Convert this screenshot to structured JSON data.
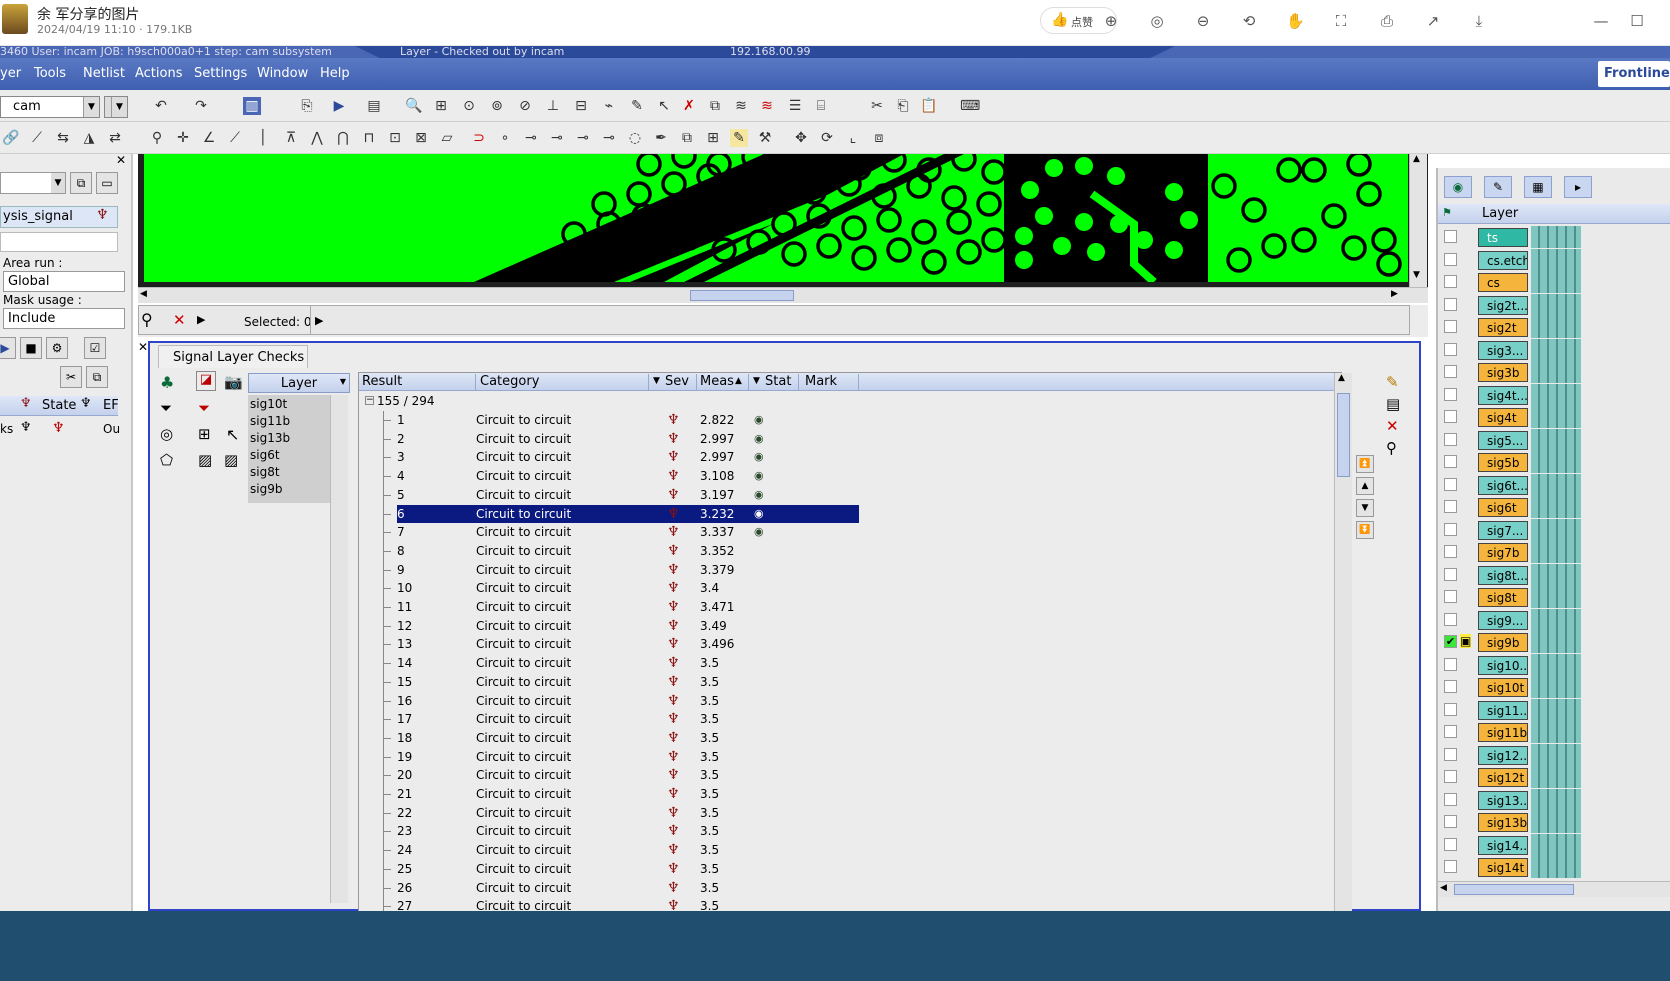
{
  "viewer": {
    "title": "余 军分享的图片",
    "meta": "2024/04/19 11:10 · 179.1KB",
    "like_label": "点赞"
  },
  "app_title": {
    "left": "3460  User: incam  JOB: h9sch000a0+1  step: cam  subsystem",
    "mid": "Layer - Checked out by incam",
    "host": "192.168.00.99"
  },
  "menu": [
    "yer",
    "Tools",
    "Netlist",
    "Actions",
    "Settings",
    "Window",
    "Help"
  ],
  "logo_text": "Frontline",
  "toolbar": {
    "step": "cam"
  },
  "left_panel": {
    "analysis": "ysis_signal",
    "area_run_label": "Area run :",
    "area_run_value": "Global",
    "mask_usage_label": "Mask usage :",
    "mask_usage_value": "Include",
    "state_label": "State",
    "er_label": "EF",
    "ks_label": "ks",
    "ou_label": "Ou"
  },
  "map": {
    "selected": "Selected: 0"
  },
  "checks": {
    "tab": "Signal Layer Checks",
    "layer_header": "Layer",
    "layers": [
      "sig10t",
      "sig11b",
      "sig13b",
      "sig6t",
      "sig8t",
      "sig9b"
    ],
    "columns": [
      "Result",
      "Category",
      "Sev",
      "Meas",
      "Stat",
      "Mark"
    ],
    "group": "155 / 294",
    "rows": [
      {
        "id": "1",
        "category": "Circuit to circuit",
        "meas": "2.822",
        "eye": true
      },
      {
        "id": "2",
        "category": "Circuit to circuit",
        "meas": "2.997",
        "eye": true
      },
      {
        "id": "3",
        "category": "Circuit to circuit",
        "meas": "2.997",
        "eye": true
      },
      {
        "id": "4",
        "category": "Circuit to circuit",
        "meas": "3.108",
        "eye": true
      },
      {
        "id": "5",
        "category": "Circuit to circuit",
        "meas": "3.197",
        "eye": true
      },
      {
        "id": "6",
        "category": "Circuit to circuit",
        "meas": "3.232",
        "eye": true,
        "selected": true
      },
      {
        "id": "7",
        "category": "Circuit to circuit",
        "meas": "3.337",
        "eye": true
      },
      {
        "id": "8",
        "category": "Circuit to circuit",
        "meas": "3.352"
      },
      {
        "id": "9",
        "category": "Circuit to circuit",
        "meas": "3.379"
      },
      {
        "id": "10",
        "category": "Circuit to circuit",
        "meas": "3.4"
      },
      {
        "id": "11",
        "category": "Circuit to circuit",
        "meas": "3.471"
      },
      {
        "id": "12",
        "category": "Circuit to circuit",
        "meas": "3.49"
      },
      {
        "id": "13",
        "category": "Circuit to circuit",
        "meas": "3.496"
      },
      {
        "id": "14",
        "category": "Circuit to circuit",
        "meas": "3.5"
      },
      {
        "id": "15",
        "category": "Circuit to circuit",
        "meas": "3.5"
      },
      {
        "id": "16",
        "category": "Circuit to circuit",
        "meas": "3.5"
      },
      {
        "id": "17",
        "category": "Circuit to circuit",
        "meas": "3.5"
      },
      {
        "id": "18",
        "category": "Circuit to circuit",
        "meas": "3.5"
      },
      {
        "id": "19",
        "category": "Circuit to circuit",
        "meas": "3.5"
      },
      {
        "id": "20",
        "category": "Circuit to circuit",
        "meas": "3.5"
      },
      {
        "id": "21",
        "category": "Circuit to circuit",
        "meas": "3.5"
      },
      {
        "id": "22",
        "category": "Circuit to circuit",
        "meas": "3.5"
      },
      {
        "id": "23",
        "category": "Circuit to circuit",
        "meas": "3.5"
      },
      {
        "id": "24",
        "category": "Circuit to circuit",
        "meas": "3.5"
      },
      {
        "id": "25",
        "category": "Circuit to circuit",
        "meas": "3.5"
      },
      {
        "id": "26",
        "category": "Circuit to circuit",
        "meas": "3.5"
      },
      {
        "id": "27",
        "category": "Circuit to circuit",
        "meas": "3.5"
      }
    ]
  },
  "layer_panel": {
    "header": "Layer",
    "layers": [
      {
        "name": "ts",
        "kind": "green"
      },
      {
        "name": "cs.etch",
        "kind": "teal"
      },
      {
        "name": "cs",
        "kind": "orange"
      },
      {
        "name": "sig2t...",
        "kind": "teal"
      },
      {
        "name": "sig2t",
        "kind": "orange"
      },
      {
        "name": "sig3...",
        "kind": "teal"
      },
      {
        "name": "sig3b",
        "kind": "orange"
      },
      {
        "name": "sig4t...",
        "kind": "teal"
      },
      {
        "name": "sig4t",
        "kind": "orange"
      },
      {
        "name": "sig5...",
        "kind": "teal"
      },
      {
        "name": "sig5b",
        "kind": "orange"
      },
      {
        "name": "sig6t...",
        "kind": "teal"
      },
      {
        "name": "sig6t",
        "kind": "orange"
      },
      {
        "name": "sig7...",
        "kind": "teal"
      },
      {
        "name": "sig7b",
        "kind": "orange"
      },
      {
        "name": "sig8t...",
        "kind": "teal"
      },
      {
        "name": "sig8t",
        "kind": "orange"
      },
      {
        "name": "sig9...",
        "kind": "teal"
      },
      {
        "name": "sig9b",
        "kind": "orange",
        "checked": true
      },
      {
        "name": "sig10...",
        "kind": "teal"
      },
      {
        "name": "sig10t",
        "kind": "orange"
      },
      {
        "name": "sig11...",
        "kind": "teal"
      },
      {
        "name": "sig11b",
        "kind": "orange"
      },
      {
        "name": "sig12...",
        "kind": "teal"
      },
      {
        "name": "sig12t",
        "kind": "orange"
      },
      {
        "name": "sig13...",
        "kind": "teal"
      },
      {
        "name": "sig13b",
        "kind": "orange"
      },
      {
        "name": "sig14...",
        "kind": "teal"
      },
      {
        "name": "sig14t",
        "kind": "orange"
      }
    ]
  },
  "colors": {
    "pcb_fill": "#00ff00",
    "selection": "#0b1a80",
    "menubar": "#3f5fb0",
    "sev": "#8b0f0f"
  }
}
